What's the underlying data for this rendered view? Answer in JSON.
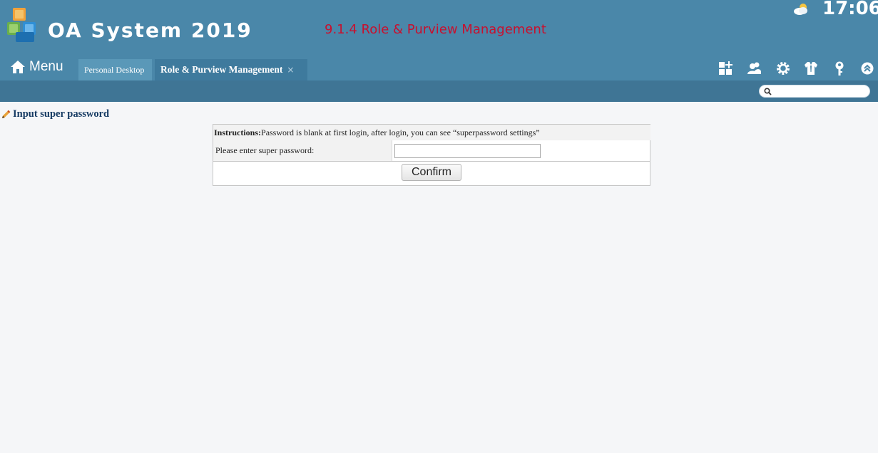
{
  "header": {
    "app_title": "OA System 2019",
    "page_caption": "9.1.4 Role  & Purview Management",
    "clock": "17:06"
  },
  "nav": {
    "menu_label": "Menu",
    "tabs": [
      {
        "label": "Personal Desktop",
        "active": false
      },
      {
        "label": "Role & Purview Management",
        "active": true,
        "close": "×"
      }
    ],
    "toolbar_icons": [
      "apps-icon",
      "user-group-icon",
      "gear-icon",
      "shirt-icon",
      "key-icon",
      "collapse-up-icon"
    ]
  },
  "search": {
    "placeholder": ""
  },
  "section": {
    "title": "Input super password"
  },
  "form": {
    "instructions_label": "Instructions:",
    "instructions_text": "Password is blank at first login, after login, you can see “superpassword settings”",
    "password_label": "Please enter super password:",
    "password_value": "",
    "confirm_label": "Confirm"
  },
  "colors": {
    "header_bg": "#4a87a9",
    "subbar_bg": "#3f7595",
    "caption_red": "#c8102e",
    "title_navy": "#163b63"
  }
}
